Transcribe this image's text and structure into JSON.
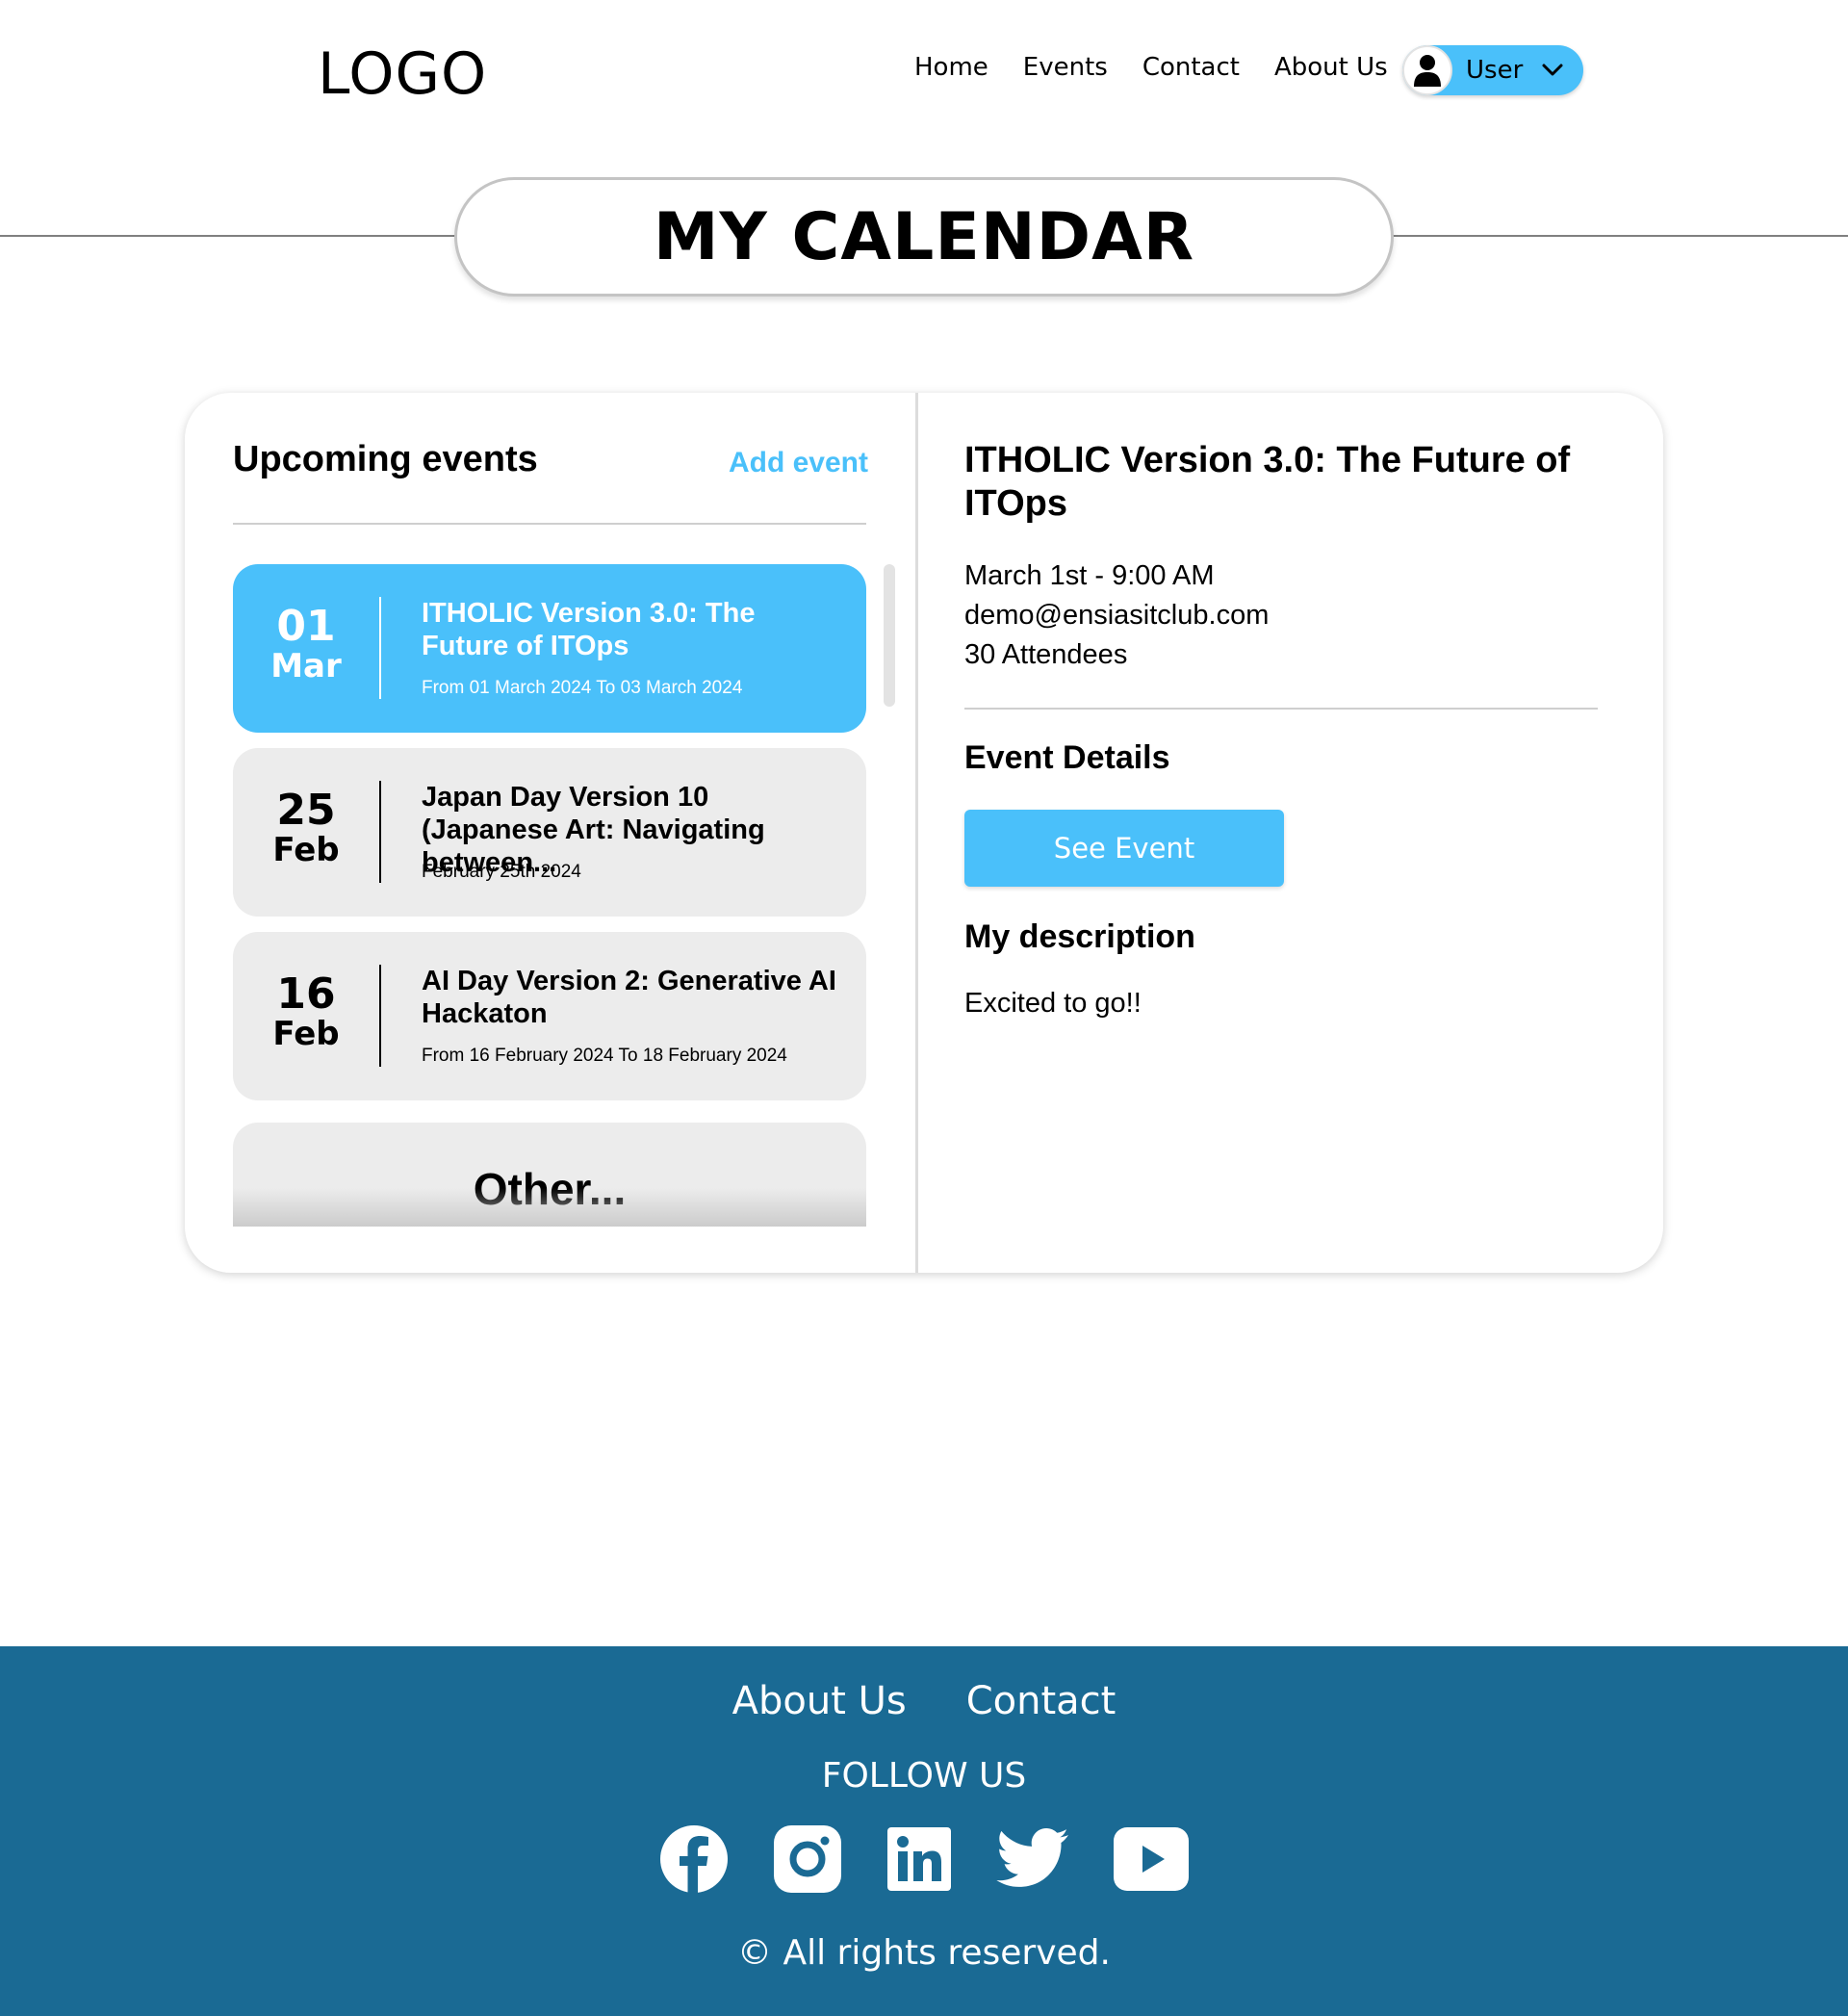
{
  "header": {
    "logo": "LOGO",
    "nav": [
      "Home",
      "Events",
      "Contact",
      "About Us"
    ],
    "user_label": "User"
  },
  "page_title": "MY CALENDAR",
  "upcoming": {
    "heading": "Upcoming events",
    "add_label": "Add event",
    "events": [
      {
        "day": "01",
        "month": "Mar",
        "title": "ITHOLIC Version 3.0: The Future of ITOps",
        "subtitle": "From 01 March 2024 To 03 March 2024",
        "selected": true
      },
      {
        "day": "25",
        "month": "Feb",
        "title": "Japan Day Version 10 (Japanese Art: Navigating between...",
        "subtitle": "February 25th 2024",
        "selected": false
      },
      {
        "day": "16",
        "month": "Feb",
        "title": "AI Day Version 2: Generative AI Hackaton",
        "subtitle": "From 16 February 2024 To 18 February 2024",
        "selected": false
      }
    ],
    "other_label": "Other..."
  },
  "detail": {
    "title": "ITHOLIC Version 3.0: The Future of ITOps",
    "datetime": "March 1st - 9:00 AM",
    "email": "demo@ensiasitclub.com",
    "attendees": "30 Attendees",
    "details_heading": "Event Details",
    "see_event_label": "See Event",
    "description_heading": "My description",
    "description": "Excited to go!!"
  },
  "footer": {
    "links": [
      "About Us",
      "Contact"
    ],
    "follow_label": "FOLLOW US",
    "socials": [
      "facebook-icon",
      "instagram-icon",
      "linkedin-icon",
      "twitter-icon",
      "youtube-icon"
    ],
    "copyright": "© All rights reserved."
  },
  "colors": {
    "accent": "#4ac0fa",
    "footer_bg": "#1a6a94",
    "item_bg": "#ececec"
  }
}
